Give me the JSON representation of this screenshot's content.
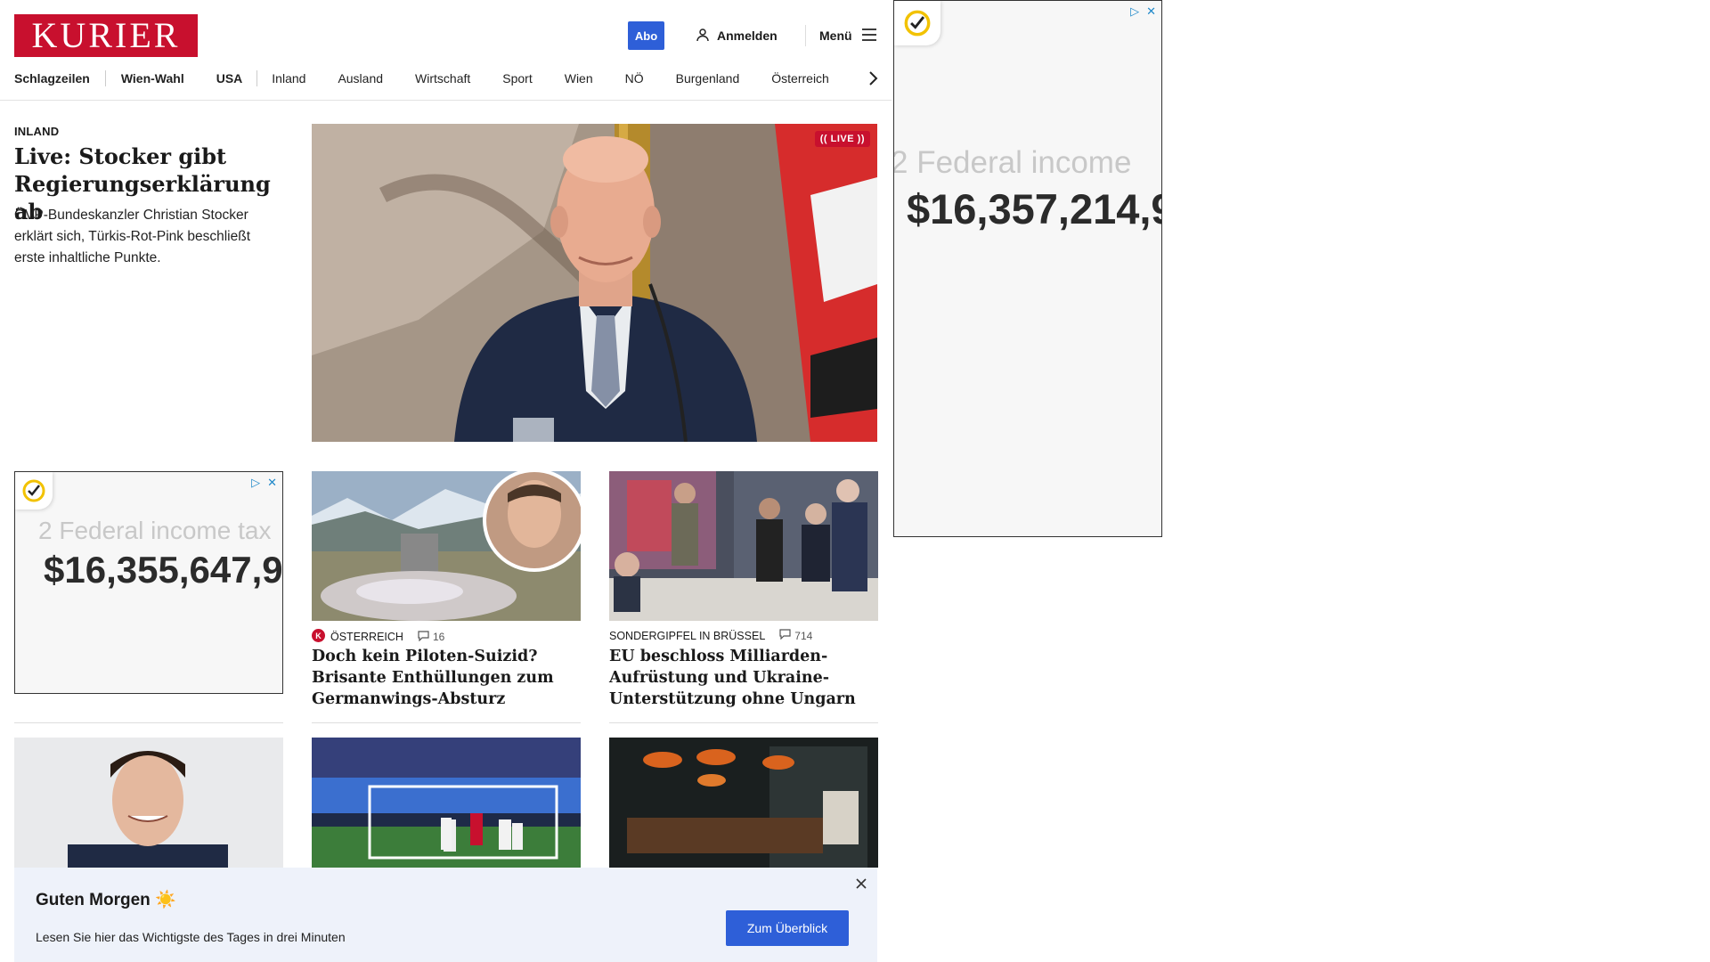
{
  "header": {
    "logo_text": "KURIER",
    "abo_label": "Abo",
    "login_label": "Anmelden",
    "menu_label": "Menü"
  },
  "nav": {
    "items": [
      "Schlagzeilen",
      "Wien-Wahl",
      "USA",
      "Inland",
      "Ausland",
      "Wirtschaft",
      "Sport",
      "Wien",
      "NÖ",
      "Burgenland",
      "Österreich"
    ]
  },
  "lead": {
    "kicker": "INLAND",
    "title": "Live: Stocker gibt Regierungserklärung ab",
    "teaser": "ÖVP-Bundeskanzler Christian Stocker erklärt sich, Türkis-Rot-Pink beschließt erste inhaltliche Punkte.",
    "live_badge": "LIVE"
  },
  "ads": {
    "small": {
      "label": "2  Federal income tax",
      "amount": "$16,355,647,9"
    },
    "side": {
      "label": "2  Federal income",
      "amount": "$16,357,214,9"
    }
  },
  "cards": [
    {
      "kicker": "ÖSTERREICH",
      "comments": "16",
      "title": "Doch kein Piloten-Suizid? Brisante Enthüllungen zum Germanwings-Absturz"
    },
    {
      "kicker": "SONDERGIPFEL IN BRÜSSEL",
      "comments": "714",
      "title": "EU beschloss Milliarden-Aufrüstung und Ukraine-Unterstützung ohne Ungarn"
    }
  ],
  "banner": {
    "title": "Guten Morgen ☀️",
    "text": "Lesen Sie hier das Wichtigste des Tages in drei Minuten",
    "button_label": "Zum Überblick"
  },
  "colors": {
    "brand_red": "#c8102e",
    "accent_blue": "#2e5fd8",
    "banner_bg": "#eef2fa"
  }
}
